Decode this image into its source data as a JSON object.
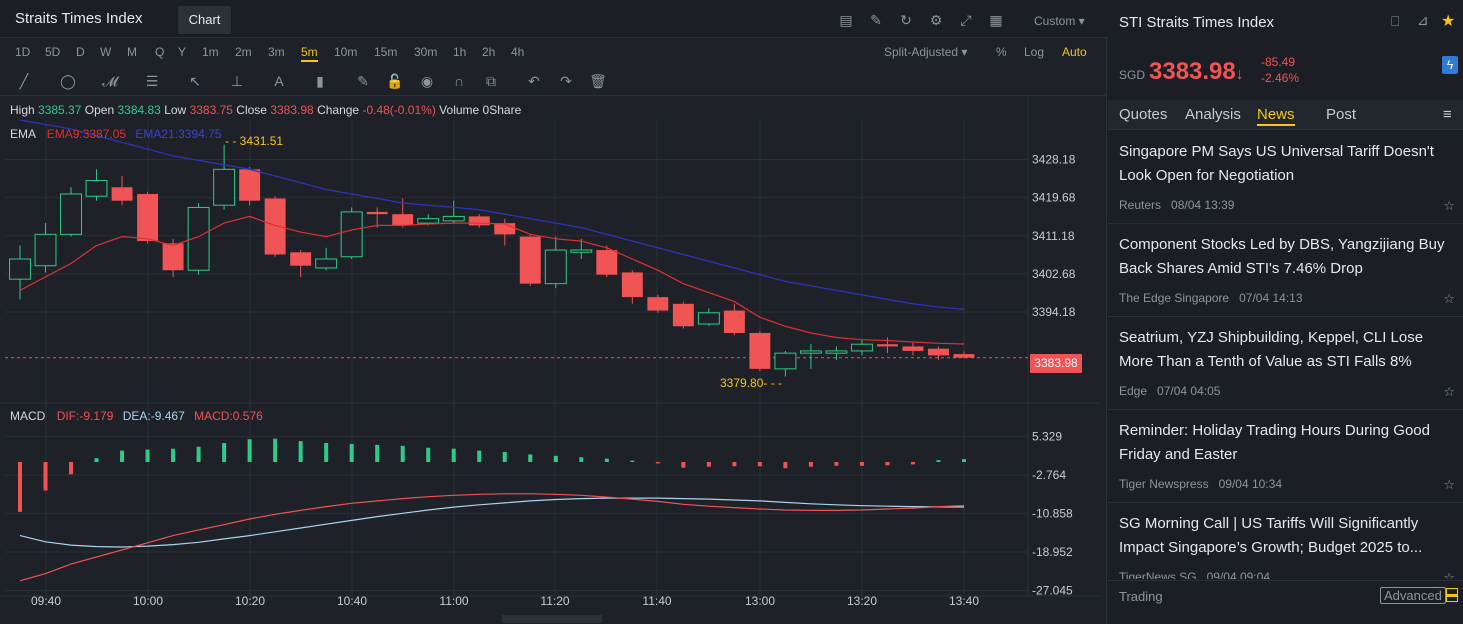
{
  "header": {
    "title": "Straits Times Index",
    "chart_tab": "Chart",
    "custom_label": "Custom"
  },
  "timeframes": [
    "1D",
    "5D",
    "D",
    "W",
    "M",
    "Q",
    "Y",
    "1m",
    "2m",
    "3m",
    "5m",
    "10m",
    "15m",
    "30m",
    "1h",
    "2h",
    "4h"
  ],
  "active_timeframe": "5m",
  "options": {
    "split": "Split-Adjusted",
    "percent": "%",
    "log": "Log",
    "auto": "Auto"
  },
  "ohlc": {
    "high_label": "High",
    "high": "3385.37",
    "open_label": "Open",
    "open": "3384.83",
    "low_label": "Low",
    "low": "3383.75",
    "close_label": "Close",
    "close": "3383.98",
    "change_label": "Change",
    "change": "-0.48(-0.01%)",
    "volume_label": "Volume",
    "volume": "0Share"
  },
  "ema_legend": {
    "name": "EMA",
    "ema9": "EMA9:3387.05",
    "ema21": "EMA21:3394.75"
  },
  "macd_legend": {
    "name": "MACD",
    "dif": "DIF:-9.179",
    "dea": "DEA:-9.467",
    "macd": "MACD:0.576"
  },
  "price_tag": "3383.98",
  "high_marker": "3431.51",
  "low_marker": "3379.80",
  "chart_data": [
    {
      "type": "candlestick",
      "title": "",
      "y_ticks": [
        3428.18,
        3419.68,
        3411.18,
        3402.68,
        3394.18
      ],
      "ylim": [
        3375,
        3437
      ],
      "x_ticks": [
        "09:40",
        "10:00",
        "10:20",
        "10:40",
        "11:00",
        "11:20",
        "11:40",
        "13:00",
        "13:20",
        "13:40"
      ],
      "last_price": 3383.98,
      "candles": [
        {
          "o": 3401.5,
          "c": 3406.0,
          "h": 3409.0,
          "l": 3397.0
        },
        {
          "o": 3404.5,
          "c": 3411.5,
          "h": 3414.0,
          "l": 3403.0
        },
        {
          "o": 3411.5,
          "c": 3420.5,
          "h": 3422.0,
          "l": 3411.0
        },
        {
          "o": 3420.0,
          "c": 3423.5,
          "h": 3426.0,
          "l": 3419.0
        },
        {
          "o": 3422.0,
          "c": 3419.0,
          "h": 3424.5,
          "l": 3418.0
        },
        {
          "o": 3420.5,
          "c": 3410.0,
          "h": 3421.0,
          "l": 3409.5
        },
        {
          "o": 3409.5,
          "c": 3403.5,
          "h": 3410.5,
          "l": 3402.0
        },
        {
          "o": 3403.5,
          "c": 3417.5,
          "h": 3418.5,
          "l": 3402.5
        },
        {
          "o": 3418.0,
          "c": 3426.0,
          "h": 3431.5,
          "l": 3417.0
        },
        {
          "o": 3426.0,
          "c": 3419.0,
          "h": 3426.5,
          "l": 3418.0
        },
        {
          "o": 3419.5,
          "c": 3407.0,
          "h": 3420.0,
          "l": 3406.5
        },
        {
          "o": 3407.5,
          "c": 3404.5,
          "h": 3408.0,
          "l": 3402.0
        },
        {
          "o": 3404.0,
          "c": 3406.0,
          "h": 3408.5,
          "l": 3403.5
        },
        {
          "o": 3406.5,
          "c": 3416.5,
          "h": 3417.5,
          "l": 3406.0
        },
        {
          "o": 3416.5,
          "c": 3416.0,
          "h": 3417.5,
          "l": 3413.0
        },
        {
          "o": 3416.0,
          "c": 3413.5,
          "h": 3419.5,
          "l": 3413.0
        },
        {
          "o": 3414.0,
          "c": 3415.0,
          "h": 3416.0,
          "l": 3413.5
        },
        {
          "o": 3414.5,
          "c": 3415.5,
          "h": 3419.0,
          "l": 3414.0
        },
        {
          "o": 3415.5,
          "c": 3413.5,
          "h": 3416.0,
          "l": 3413.0
        },
        {
          "o": 3414.0,
          "c": 3411.5,
          "h": 3415.0,
          "l": 3409.0
        },
        {
          "o": 3411.0,
          "c": 3400.5,
          "h": 3411.5,
          "l": 3400.0
        },
        {
          "o": 3400.5,
          "c": 3408.0,
          "h": 3411.0,
          "l": 3399.5
        },
        {
          "o": 3407.5,
          "c": 3408.0,
          "h": 3410.5,
          "l": 3406.0
        },
        {
          "o": 3408.0,
          "c": 3402.5,
          "h": 3409.0,
          "l": 3402.0
        },
        {
          "o": 3403.0,
          "c": 3397.5,
          "h": 3403.5,
          "l": 3396.0
        },
        {
          "o": 3397.5,
          "c": 3394.5,
          "h": 3398.0,
          "l": 3394.0
        },
        {
          "o": 3396.0,
          "c": 3391.0,
          "h": 3396.5,
          "l": 3390.5
        },
        {
          "o": 3391.5,
          "c": 3394.0,
          "h": 3395.0,
          "l": 3391.0
        },
        {
          "o": 3394.5,
          "c": 3389.5,
          "h": 3396.0,
          "l": 3389.0
        },
        {
          "o": 3389.5,
          "c": 3381.5,
          "h": 3390.0,
          "l": 3381.0
        },
        {
          "o": 3381.5,
          "c": 3385.0,
          "h": 3385.5,
          "l": 3379.8
        },
        {
          "o": 3385.0,
          "c": 3385.5,
          "h": 3387.0,
          "l": 3381.5
        },
        {
          "o": 3385.0,
          "c": 3385.5,
          "h": 3386.5,
          "l": 3383.5
        },
        {
          "o": 3385.5,
          "c": 3387.0,
          "h": 3388.0,
          "l": 3384.5
        },
        {
          "o": 3387.0,
          "c": 3386.5,
          "h": 3388.5,
          "l": 3385.0
        },
        {
          "o": 3386.5,
          "c": 3385.5,
          "h": 3387.5,
          "l": 3384.5
        },
        {
          "o": 3386.0,
          "c": 3384.5,
          "h": 3386.5,
          "l": 3383.5
        },
        {
          "o": 3384.8,
          "c": 3384.0,
          "h": 3385.4,
          "l": 3383.8
        }
      ],
      "ema9": [
        3399,
        3402,
        3405,
        3409,
        3411,
        3410.5,
        3409,
        3411,
        3414,
        3415.5,
        3413.5,
        3412,
        3411,
        3412.5,
        3413.5,
        3413.5,
        3413.8,
        3414,
        3414,
        3413.8,
        3411.5,
        3410.5,
        3410,
        3408.5,
        3406,
        3403.5,
        3400.5,
        3398.5,
        3396.5,
        3393,
        3391,
        3389.5,
        3388.5,
        3388,
        3387.8,
        3387.5,
        3387.2,
        3387.05
      ],
      "ema21": [
        3437,
        3436,
        3435,
        3433.5,
        3432,
        3430.5,
        3429,
        3428,
        3427,
        3426,
        3424.5,
        3423,
        3421.5,
        3420.5,
        3419.5,
        3418.5,
        3418,
        3417.5,
        3417,
        3416,
        3415,
        3414,
        3413,
        3411.5,
        3410,
        3408.5,
        3407,
        3405.5,
        3404,
        3402.5,
        3401,
        3400,
        3399,
        3398,
        3397,
        3396,
        3395.3,
        3394.75
      ]
    },
    {
      "type": "bar",
      "title": "",
      "y_ticks": [
        5.329,
        -2.764,
        -10.858,
        -18.952,
        -27.045
      ],
      "ylim": [
        -28,
        12
      ],
      "macd": [
        -10.5,
        -6,
        -2.6,
        0.8,
        2.4,
        2.6,
        2.8,
        3.2,
        4.0,
        4.8,
        4.9,
        4.4,
        4.0,
        3.8,
        3.6,
        3.4,
        3.0,
        2.8,
        2.4,
        2.1,
        1.6,
        1.3,
        1.0,
        0.7,
        0.3,
        -0.3,
        -1.2,
        -1.0,
        -0.9,
        -0.9,
        -1.3,
        -1.0,
        -0.8,
        -0.8,
        -0.7,
        -0.5,
        0.4,
        0.6
      ],
      "dif": [
        -25,
        -23.5,
        -21.5,
        -20,
        -18.5,
        -17,
        -15.5,
        -14.3,
        -13.2,
        -12.0,
        -11.0,
        -10.2,
        -9.4,
        -8.7,
        -8.2,
        -7.7,
        -7.3,
        -7.0,
        -6.8,
        -6.7,
        -6.7,
        -6.8,
        -7.0,
        -7.4,
        -7.8,
        -8.3,
        -8.9,
        -9.3,
        -9.6,
        -9.9,
        -10.1,
        -10.2,
        -10.2,
        -10.1,
        -9.9,
        -9.7,
        -9.4,
        -9.18
      ],
      "dea": [
        -15.5,
        -16.8,
        -17.5,
        -17.8,
        -17.9,
        -17.7,
        -17.4,
        -16.9,
        -16.2,
        -15.5,
        -14.7,
        -13.9,
        -13.1,
        -12.3,
        -11.5,
        -10.8,
        -10.1,
        -9.5,
        -9.0,
        -8.6,
        -8.2,
        -7.9,
        -7.7,
        -7.6,
        -7.6,
        -7.6,
        -7.7,
        -7.8,
        -8.0,
        -8.2,
        -8.5,
        -8.8,
        -9.0,
        -9.2,
        -9.3,
        -9.4,
        -9.45,
        -9.467
      ]
    }
  ],
  "side": {
    "title": "STI Straits Times Index",
    "currency": "SGD",
    "price": "3383.98",
    "arrow": "↓",
    "change": "-85.49",
    "change_pct": "-2.46%",
    "tabs": [
      "Quotes",
      "Analysis",
      "News",
      "Post"
    ],
    "active_tab": "News",
    "news": [
      {
        "headline": "Singapore PM Says US Universal Tariff Doesn't Look Open for Negotiation",
        "source": "Reuters",
        "time": "08/04 13:39"
      },
      {
        "headline": "Component Stocks Led by DBS, Yangzijiang Buy Back Shares Amid STI's 7.46% Drop",
        "source": "The Edge Singapore",
        "time": "07/04 14:13"
      },
      {
        "headline": "Seatrium, YZJ Shipbuilding, Keppel, CLI Lose More Than a Tenth of Value as STI Falls 8%",
        "source": "Edge",
        "time": "07/04 04:05"
      },
      {
        "headline": "Reminder: Holiday Trading Hours During Good Friday and Easter",
        "source": "Tiger Newspress",
        "time": "09/04 10:34"
      },
      {
        "headline": "SG Morning Call | US Tariffs Will Significantly Impact Singapore’s Growth; Budget 2025 to...",
        "source": "TigerNews SG",
        "time": "09/04 09:04"
      }
    ],
    "footer_trading": "Trading",
    "footer_advanced": "Advanced"
  },
  "colors": {
    "up": "#2ecc87",
    "down": "#f05454",
    "ema9": "#e03030",
    "ema21": "#2b33b8",
    "dea": "#a8d4ee",
    "accent": "#f5c518"
  }
}
